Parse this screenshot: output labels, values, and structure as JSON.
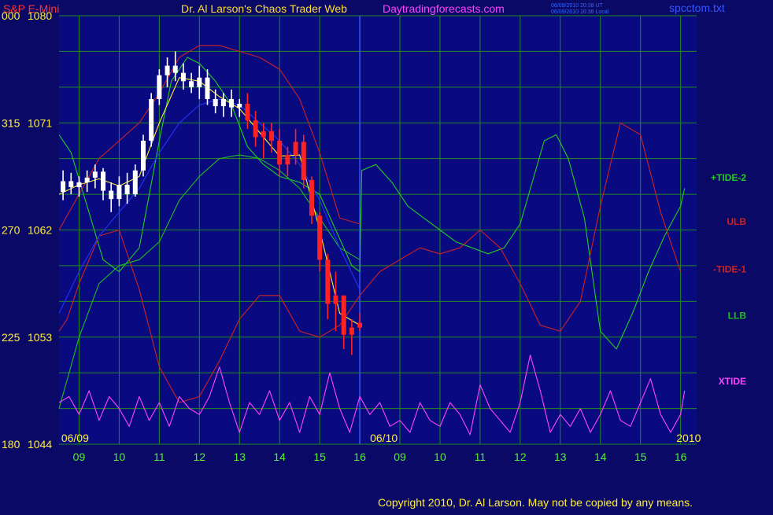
{
  "header": {
    "symbol": "S&P E-Mini",
    "title": "Dr. Al Larson's Chaos Trader Web",
    "site": "Daytradingforecasts.com",
    "time_utc": "06/09/2010 20:38 UT",
    "time_local": "06/09/2010 16:38 Local",
    "file": "spcctom.txt"
  },
  "footer": {
    "copyright": "Copyright 2010, Dr. Al Larson. May not be copied by any means."
  },
  "colors": {
    "background": "#0a0a66",
    "plot_background": "#0a0a80",
    "grid": "#1f8a1f",
    "tick_text": "#55ee33",
    "price_bars": "#ffffff",
    "price_bars_recent": "#ff2222",
    "tide2": "#22cc22",
    "tide1": "#cc2222",
    "ulb": "#cc2222",
    "llb": "#22bb22",
    "xtide": "#ff44ff",
    "ma_blue": "#2233ff",
    "ma_yellow": "#ffee33"
  },
  "chart_data": {
    "type": "line",
    "title": "S&P E-Mini",
    "xlabel": "",
    "ylabel": "",
    "ylim": [
      1044,
      1080
    ],
    "xlim": [
      8.5,
      24.4
    ],
    "grid": true,
    "y_ticks_left": [
      {
        "code": "000",
        "price": "1080",
        "value": 1080
      },
      {
        "code": "315",
        "price": "1071",
        "value": 1071
      },
      {
        "code": "270",
        "price": "1062",
        "value": 1062
      },
      {
        "code": "225",
        "price": "1053",
        "value": 1053
      },
      {
        "code": "180",
        "price": "1044",
        "value": 1044
      }
    ],
    "x_ticks": [
      {
        "label": "09",
        "x": 9
      },
      {
        "label": "10",
        "x": 10
      },
      {
        "label": "11",
        "x": 11
      },
      {
        "label": "12",
        "x": 12
      },
      {
        "label": "13",
        "x": 13
      },
      {
        "label": "14",
        "x": 14
      },
      {
        "label": "15",
        "x": 15
      },
      {
        "label": "16",
        "x": 16
      },
      {
        "label": "09",
        "x": 17
      },
      {
        "label": "10",
        "x": 18
      },
      {
        "label": "11",
        "x": 19
      },
      {
        "label": "12",
        "x": 20
      },
      {
        "label": "13",
        "x": 21
      },
      {
        "label": "14",
        "x": 22
      },
      {
        "label": "15",
        "x": 23
      },
      {
        "label": "16",
        "x": 24
      }
    ],
    "date_labels": [
      {
        "label": "06/09",
        "x": 8.9
      },
      {
        "label": "06/10",
        "x": 16.6
      },
      {
        "label": "2010",
        "x": 24.2
      }
    ],
    "series_labels": [
      {
        "name": "+TIDE-2",
        "color": "#22cc22",
        "value": 1066.4
      },
      {
        "name": "ULB",
        "color": "#cc2222",
        "value": 1062.7
      },
      {
        "name": "-TIDE-1",
        "color": "#cc2222",
        "value": 1058.7
      },
      {
        "name": "LLB",
        "color": "#22bb22",
        "value": 1054.8
      },
      {
        "name": "XTIDE",
        "color": "#ff44ff",
        "value": 1049.3
      }
    ],
    "now_x": 16.0,
    "price_bars": [
      {
        "x": 8.6,
        "high": 1067.0,
        "low": 1064.5,
        "open": 1065.2,
        "close": 1066.1
      },
      {
        "x": 8.8,
        "high": 1066.8,
        "low": 1065.0,
        "open": 1066.1,
        "close": 1065.6
      },
      {
        "x": 9.0,
        "high": 1066.5,
        "low": 1064.8,
        "open": 1065.6,
        "close": 1066.0
      },
      {
        "x": 9.2,
        "high": 1067.0,
        "low": 1065.2,
        "open": 1066.0,
        "close": 1066.4
      },
      {
        "x": 9.4,
        "high": 1067.5,
        "low": 1065.5,
        "open": 1066.4,
        "close": 1066.9
      },
      {
        "x": 9.6,
        "high": 1067.2,
        "low": 1064.5,
        "open": 1066.9,
        "close": 1065.3
      },
      {
        "x": 9.8,
        "high": 1066.0,
        "low": 1063.5,
        "open": 1065.3,
        "close": 1064.6
      },
      {
        "x": 10.0,
        "high": 1066.5,
        "low": 1064.0,
        "open": 1064.6,
        "close": 1065.8
      },
      {
        "x": 10.2,
        "high": 1066.8,
        "low": 1064.2,
        "open": 1065.8,
        "close": 1065.0
      },
      {
        "x": 10.4,
        "high": 1067.5,
        "low": 1064.8,
        "open": 1065.0,
        "close": 1067.0
      },
      {
        "x": 10.6,
        "high": 1070.0,
        "low": 1066.5,
        "open": 1067.0,
        "close": 1069.5
      },
      {
        "x": 10.8,
        "high": 1073.5,
        "low": 1069.0,
        "open": 1069.5,
        "close": 1073.0
      },
      {
        "x": 11.0,
        "high": 1075.5,
        "low": 1072.5,
        "open": 1073.0,
        "close": 1075.0
      },
      {
        "x": 11.2,
        "high": 1076.5,
        "low": 1074.0,
        "open": 1075.0,
        "close": 1075.8
      },
      {
        "x": 11.4,
        "high": 1077.0,
        "low": 1074.5,
        "open": 1075.8,
        "close": 1075.2
      },
      {
        "x": 11.6,
        "high": 1076.0,
        "low": 1073.8,
        "open": 1075.2,
        "close": 1074.5
      },
      {
        "x": 11.8,
        "high": 1075.2,
        "low": 1073.5,
        "open": 1074.5,
        "close": 1074.0
      },
      {
        "x": 12.0,
        "high": 1075.8,
        "low": 1073.0,
        "open": 1074.0,
        "close": 1074.8
      },
      {
        "x": 12.2,
        "high": 1075.5,
        "low": 1072.5,
        "open": 1074.8,
        "close": 1073.0
      },
      {
        "x": 12.4,
        "high": 1073.8,
        "low": 1071.8,
        "open": 1073.0,
        "close": 1072.4
      },
      {
        "x": 12.6,
        "high": 1073.5,
        "low": 1071.5,
        "open": 1072.4,
        "close": 1073.0
      },
      {
        "x": 12.8,
        "high": 1073.8,
        "low": 1071.5,
        "open": 1073.0,
        "close": 1072.3
      },
      {
        "x": 13.0,
        "high": 1073.0,
        "low": 1071.5,
        "open": 1072.3,
        "close": 1072.6
      },
      {
        "x": 13.2,
        "high": 1073.5,
        "low": 1070.5,
        "open": 1072.6,
        "close": 1071.2
      },
      {
        "x": 13.4,
        "high": 1072.0,
        "low": 1069.0,
        "open": 1071.2,
        "close": 1069.8
      },
      {
        "x": 13.6,
        "high": 1071.0,
        "low": 1068.0,
        "open": 1069.8,
        "close": 1070.3
      },
      {
        "x": 13.8,
        "high": 1071.0,
        "low": 1068.5,
        "open": 1070.3,
        "close": 1069.5
      },
      {
        "x": 14.0,
        "high": 1070.5,
        "low": 1066.5,
        "open": 1069.5,
        "close": 1067.5
      },
      {
        "x": 14.2,
        "high": 1069.0,
        "low": 1066.5,
        "open": 1067.5,
        "close": 1068.3
      },
      {
        "x": 14.4,
        "high": 1070.5,
        "low": 1067.5,
        "open": 1068.3,
        "close": 1069.4
      },
      {
        "x": 14.6,
        "high": 1070.0,
        "low": 1065.5,
        "open": 1069.4,
        "close": 1066.2
      },
      {
        "x": 14.8,
        "high": 1066.5,
        "low": 1062.5,
        "open": 1066.2,
        "close": 1063.2
      },
      {
        "x": 15.0,
        "high": 1063.5,
        "low": 1058.5,
        "open": 1063.2,
        "close": 1059.5
      },
      {
        "x": 15.2,
        "high": 1060.0,
        "low": 1054.5,
        "open": 1059.5,
        "close": 1055.8
      },
      {
        "x": 15.4,
        "high": 1058.5,
        "low": 1053.5,
        "open": 1055.8,
        "close": 1056.5
      },
      {
        "x": 15.6,
        "high": 1055.5,
        "low": 1052.0,
        "open": 1056.5,
        "close": 1053.2
      },
      {
        "x": 15.8,
        "high": 1054.5,
        "low": 1051.5,
        "open": 1053.2,
        "close": 1053.8
      },
      {
        "x": 16.0,
        "high": 1055.0,
        "low": 1053.5,
        "open": 1053.8,
        "close": 1054.2
      }
    ],
    "series": [
      {
        "color": "#22cc22",
        "x": [
          8.5,
          8.8,
          9.2,
          9.6,
          10.0,
          10.5,
          11.0,
          11.3,
          11.7,
          12.0,
          12.4,
          12.8,
          13.2,
          13.6,
          14.0,
          14.5,
          15.0,
          15.4,
          15.8,
          16.0,
          16.05,
          16.4,
          16.8,
          17.2,
          17.6,
          18.0,
          18.4,
          18.8,
          19.2,
          19.6,
          20.0,
          20.3,
          20.6,
          20.9,
          21.2,
          21.6,
          22.0,
          22.4,
          22.8,
          23.2,
          23.6,
          24.0,
          24.1
        ],
        "y": [
          1070.0,
          1068.5,
          1064.0,
          1059.5,
          1058.5,
          1060.5,
          1069.5,
          1074.5,
          1076.5,
          1076.0,
          1074.5,
          1072.5,
          1069.0,
          1067.5,
          1066.5,
          1066.0,
          1065.0,
          1062.0,
          1059.0,
          1058.5,
          1067.0,
          1067.5,
          1066.0,
          1064.0,
          1063.0,
          1062.0,
          1061.0,
          1060.5,
          1060.0,
          1060.5,
          1062.5,
          1066.0,
          1069.5,
          1070.0,
          1068.0,
          1063.0,
          1053.5,
          1052.0,
          1055.0,
          1058.5,
          1061.5,
          1064.0,
          1065.5
        ]
      },
      {
        "color": "#cc2222",
        "x": [
          8.5,
          8.7,
          9.0,
          9.5,
          10.0,
          10.5,
          11.0,
          11.5,
          12.0,
          12.5,
          13.0,
          13.5,
          14.0,
          14.5,
          15.0,
          15.5,
          16.0,
          16.5,
          17.0,
          17.5,
          18.0,
          18.5,
          19.0,
          19.5,
          20.0,
          20.5,
          21.0,
          21.5,
          22.0,
          22.5,
          23.0,
          23.5,
          24.0
        ],
        "y": [
          1053.5,
          1054.5,
          1057.5,
          1061.5,
          1062.0,
          1057.0,
          1050.5,
          1047.5,
          1048.0,
          1051.0,
          1054.5,
          1056.5,
          1056.5,
          1053.5,
          1053.0,
          1054.0,
          1056.5,
          1058.5,
          1059.5,
          1060.5,
          1060.0,
          1060.5,
          1062.0,
          1060.5,
          1057.5,
          1054.0,
          1053.5,
          1056.0,
          1064.0,
          1071.0,
          1070.0,
          1063.5,
          1058.5
        ]
      },
      {
        "color": "#cc2222",
        "x": [
          8.5,
          9.0,
          9.5,
          10.0,
          10.5,
          11.0,
          11.5,
          12.0,
          12.5,
          13.0,
          13.5,
          14.0,
          14.5,
          15.0,
          15.5,
          16.0
        ],
        "y": [
          1062.0,
          1065.0,
          1068.0,
          1069.5,
          1071.0,
          1073.5,
          1076.5,
          1077.5,
          1077.5,
          1077.0,
          1076.5,
          1075.5,
          1073.0,
          1068.5,
          1063.0,
          1062.5
        ]
      },
      {
        "color": "#22bb22",
        "x": [
          8.5,
          9.0,
          9.5,
          10.0,
          10.5,
          11.0,
          11.5,
          12.0,
          12.5,
          13.0,
          13.5,
          14.0,
          14.5,
          15.0,
          15.5,
          16.0
        ],
        "y": [
          1047.0,
          1053.0,
          1057.5,
          1059.0,
          1059.5,
          1061.0,
          1064.5,
          1066.5,
          1068.0,
          1068.3,
          1068.0,
          1067.0,
          1065.5,
          1063.0,
          1060.5,
          1059.5
        ]
      },
      {
        "color": "#2233ff",
        "x": [
          8.5,
          9.0,
          9.5,
          10.0,
          10.5,
          11.0,
          11.5,
          12.0,
          12.5,
          13.0,
          13.5,
          14.0,
          14.5,
          15.0,
          15.5,
          16.0
        ],
        "y": [
          1055.0,
          1058.5,
          1061.5,
          1063.5,
          1065.5,
          1068.5,
          1071.0,
          1072.5,
          1073.0,
          1072.5,
          1071.0,
          1069.5,
          1067.5,
          1064.5,
          1060.5,
          1057.0
        ]
      },
      {
        "color": "#ffee33",
        "x": [
          8.5,
          9.0,
          9.5,
          10.0,
          10.5,
          11.0,
          11.5,
          12.0,
          12.5,
          13.0,
          13.5,
          14.0,
          14.5,
          15.0,
          15.5,
          16.0
        ],
        "y": [
          1065.0,
          1065.8,
          1066.3,
          1065.7,
          1066.5,
          1071.0,
          1074.8,
          1074.5,
          1073.2,
          1072.2,
          1070.2,
          1068.2,
          1068.3,
          1062.0,
          1055.0,
          1054.0
        ]
      },
      {
        "color": "#ff44ff",
        "x": [
          8.5,
          8.75,
          9.0,
          9.25,
          9.5,
          9.75,
          10.0,
          10.25,
          10.5,
          10.75,
          11.0,
          11.25,
          11.5,
          11.75,
          12.0,
          12.25,
          12.5,
          12.75,
          13.0,
          13.25,
          13.5,
          13.75,
          14.0,
          14.25,
          14.5,
          14.75,
          15.0,
          15.25,
          15.5,
          15.75,
          16.0,
          16.25,
          16.5,
          16.75,
          17.0,
          17.25,
          17.5,
          17.75,
          18.0,
          18.25,
          18.5,
          18.75,
          19.0,
          19.25,
          19.5,
          19.75,
          20.0,
          20.25,
          20.5,
          20.75,
          21.0,
          21.25,
          21.5,
          21.75,
          22.0,
          22.25,
          22.5,
          22.75,
          23.0,
          23.25,
          23.5,
          23.75,
          24.0,
          24.1
        ],
        "y": [
          1047.5,
          1048.0,
          1046.5,
          1048.5,
          1046.0,
          1048.0,
          1047.0,
          1045.5,
          1048.0,
          1046.0,
          1047.5,
          1045.5,
          1048.0,
          1047.0,
          1046.5,
          1048.0,
          1050.5,
          1047.5,
          1045.0,
          1047.5,
          1046.5,
          1048.5,
          1046.0,
          1047.5,
          1045.0,
          1048.0,
          1046.5,
          1050.0,
          1047.0,
          1045.0,
          1048.0,
          1046.5,
          1047.5,
          1045.5,
          1046.0,
          1045.0,
          1047.5,
          1046.0,
          1045.5,
          1047.5,
          1046.5,
          1044.8,
          1049.0,
          1047.0,
          1046.0,
          1045.0,
          1047.5,
          1051.5,
          1048.5,
          1045.0,
          1046.5,
          1045.5,
          1047.0,
          1045.0,
          1046.5,
          1048.5,
          1046.0,
          1045.5,
          1047.5,
          1049.5,
          1046.5,
          1045.0,
          1046.5,
          1048.5
        ]
      }
    ]
  }
}
